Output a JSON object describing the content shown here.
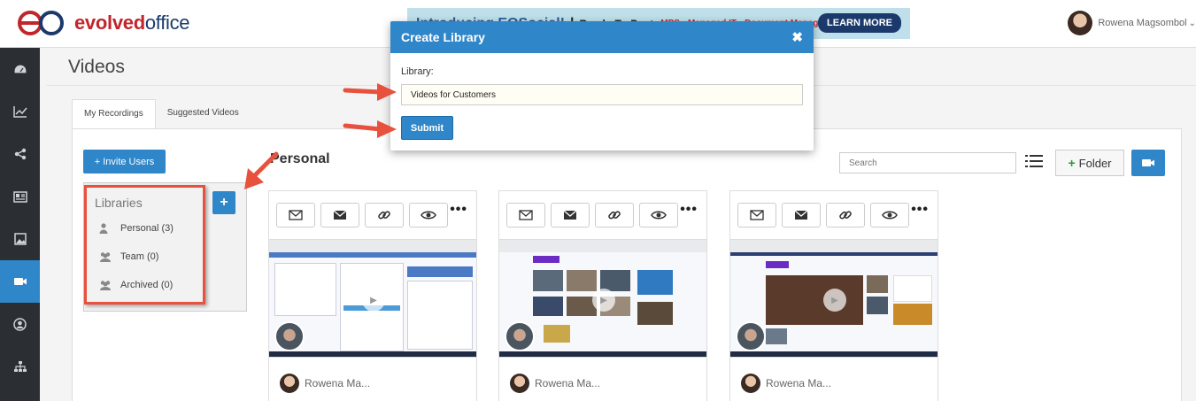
{
  "header": {
    "logo_prefix": "evolved",
    "logo_suffix": "office",
    "banner": {
      "intro": "Introducing EOSocial!",
      "separator": "|",
      "ready": "Ready-To-Post",
      "services": "MPS • Managed IT • Document Management",
      "learn_more": "LEARN MORE"
    },
    "user_name": "Rowena Magsombol",
    "user_caret": "⌄"
  },
  "sidebar": {
    "items": [
      {
        "icon": "dashboard-icon",
        "active": false
      },
      {
        "icon": "chart-line-icon",
        "active": false
      },
      {
        "icon": "share-icon",
        "active": false
      },
      {
        "icon": "newspaper-icon",
        "active": false
      },
      {
        "icon": "image-icon",
        "active": false
      },
      {
        "icon": "video-camera-icon",
        "active": true
      },
      {
        "icon": "user-circle-icon",
        "active": false
      },
      {
        "icon": "sitemap-icon",
        "active": false
      }
    ]
  },
  "main": {
    "page_title": "Videos",
    "tabs": [
      {
        "label": "My Recordings",
        "active": true
      },
      {
        "label": "Suggested Videos",
        "active": false
      }
    ],
    "invite_users": "+ Invite Users",
    "libraries": {
      "title": "Libraries",
      "add_label": "+",
      "items": [
        {
          "label": "Personal (3)",
          "icon": "user-icon"
        },
        {
          "label": "Team (0)",
          "icon": "users-icon"
        },
        {
          "label": "Archived (0)",
          "icon": "users-icon"
        }
      ]
    },
    "section_title": "Personal",
    "search_placeholder": "Search",
    "folder_plus": "+",
    "folder_label": "Folder",
    "cards": [
      {
        "owner": "Rowena Ma..."
      },
      {
        "owner": "Rowena Ma..."
      },
      {
        "owner": "Rowena Ma..."
      }
    ],
    "more_label": "•••"
  },
  "modal": {
    "title": "Create Library",
    "close": "✖",
    "field_label": "Library:",
    "field_value": "Videos for Customers",
    "submit": "Submit"
  },
  "colors": {
    "primary": "#2f86c9",
    "sidebar_bg": "#2b2f33",
    "annotation_red": "#e8513d",
    "brand_red": "#c0262c",
    "brand_navy": "#1b3a6b"
  }
}
